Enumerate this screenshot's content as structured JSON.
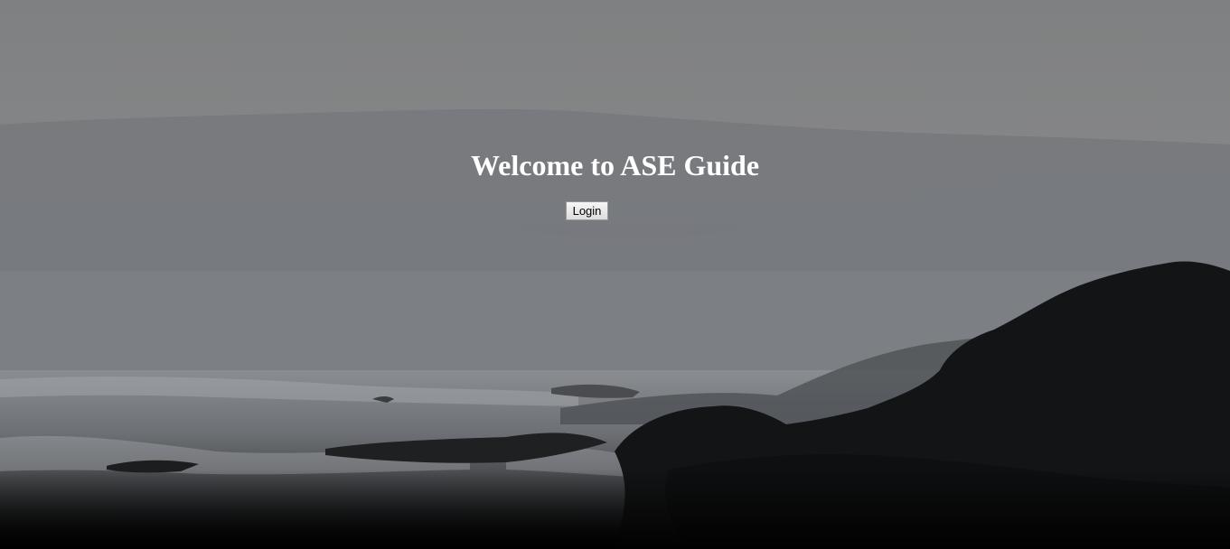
{
  "page": {
    "title": "Welcome to ASE Guide"
  },
  "actions": {
    "login_label": "Login"
  },
  "colors": {
    "sky": "#858687",
    "mist": "#7b7e82",
    "sea": "#5a5c60",
    "rocks": "#121314",
    "title_text": "#ffffff"
  }
}
